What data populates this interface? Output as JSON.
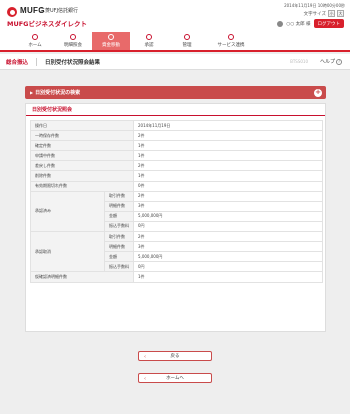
{
  "header": {
    "bank_name": "三菱UFJ信託銀行",
    "brand": "MUFG",
    "service_name": "MUFGビジネスダイレクト",
    "last_login": "2014年11月19日 10時00分00秒",
    "font_size_label": "文字サイズ",
    "font_small": "小",
    "font_large": "大",
    "user_name": "○○ 太郎 様",
    "logout_label": "ログアウト"
  },
  "nav": {
    "items": [
      {
        "label": "ホーム"
      },
      {
        "label": "明細照会"
      },
      {
        "label": "資金移動"
      },
      {
        "label": "承認"
      },
      {
        "label": "管理"
      },
      {
        "label": "サービス連携"
      }
    ]
  },
  "titlebar": {
    "breadcrumb": "総合振込",
    "title": "日別受付状況照会結果",
    "page_id": "BTSS010",
    "help": "ヘルプ"
  },
  "search_panel": {
    "label": "日別受付状況の検索"
  },
  "result": {
    "heading": "日別受付状況照会",
    "rows": {
      "date": {
        "label": "操作日",
        "value": "2014年11月19日"
      },
      "temp": {
        "label": "一時保存件数",
        "value": "2件"
      },
      "confirmed": {
        "label": "確定件数",
        "value": "1件"
      },
      "applying": {
        "label": "申請中件数",
        "value": "1件"
      },
      "returned": {
        "label": "差戻し件数",
        "value": "2件"
      },
      "deleted": {
        "label": "削除件数",
        "value": "1件"
      },
      "expired": {
        "label": "有効期限切れ件数",
        "value": "0件"
      },
      "approved": {
        "label": "承認済み",
        "count": {
          "label": "取引件数",
          "value": "2件"
        },
        "items": {
          "label": "明細件数",
          "value": "3件"
        },
        "amount": {
          "label": "金額",
          "value": "5,000,000円"
        },
        "fee": {
          "label": "振込手数料",
          "value": "0円"
        }
      },
      "scheduled": {
        "label": "承認取消",
        "count": {
          "label": "取引件数",
          "value": "2件"
        },
        "items": {
          "label": "明細件数",
          "value": "3件"
        },
        "amount": {
          "label": "金額",
          "value": "5,000,000円"
        },
        "fee": {
          "label": "振込手数料",
          "value": "0円"
        }
      },
      "rejected": {
        "label": "仮確認済明細件数",
        "value": "1件"
      }
    }
  },
  "buttons": {
    "back": "戻る",
    "home": "ホームへ"
  }
}
